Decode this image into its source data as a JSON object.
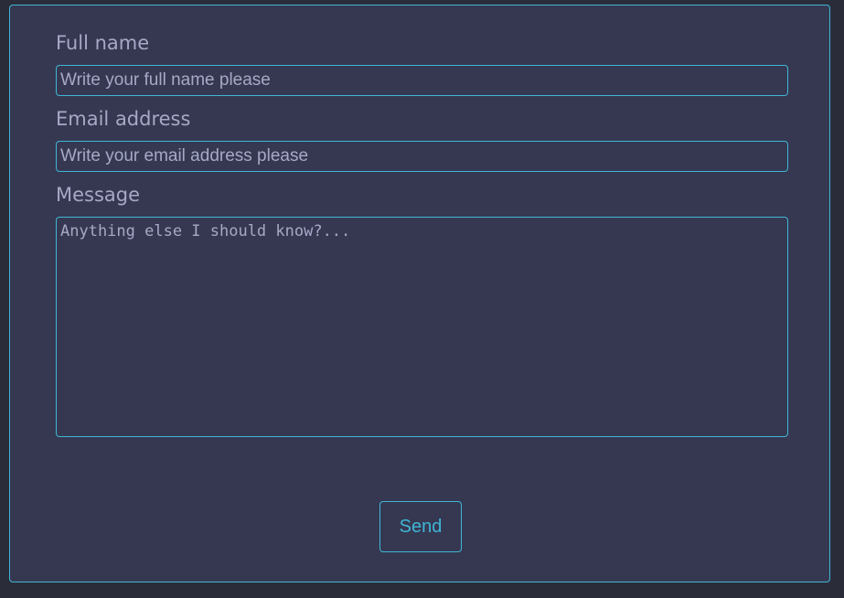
{
  "form": {
    "fields": [
      {
        "label": "Full name",
        "placeholder": "Write your full name please",
        "value": ""
      },
      {
        "label": "Email address",
        "placeholder": "Write your email address please",
        "value": ""
      }
    ],
    "message": {
      "label": "Message",
      "placeholder": "Anything else I should know?...",
      "value": ""
    },
    "submit_label": "Send"
  },
  "colors": {
    "page_background": "#2b2c39",
    "panel_background": "#363851",
    "accent": "#3fb6d6",
    "text": "#a6a9c6"
  }
}
